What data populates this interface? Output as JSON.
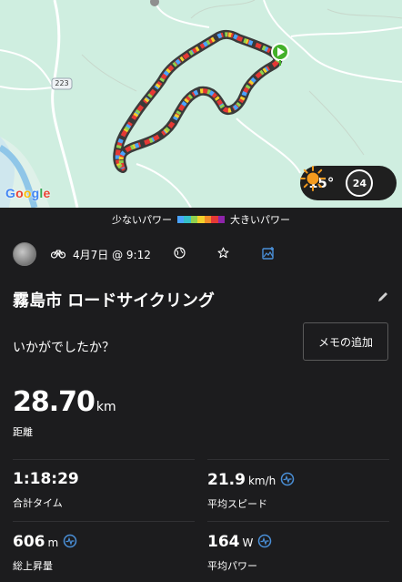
{
  "map": {
    "road_number": "223",
    "google_logo": [
      "G",
      "o",
      "o",
      "g",
      "l",
      "e"
    ],
    "google_colors": [
      "#4285F4",
      "#EA4335",
      "#FBBC05",
      "#4285F4",
      "#34A853",
      "#EA4335"
    ],
    "weather": {
      "temperature": "15°",
      "icon": "sun-icon",
      "uv_index": "24"
    }
  },
  "legend": {
    "low_label": "少ないパワー",
    "high_label": "大きいパワー",
    "colors": [
      "#4aa3ff",
      "#35c0c8",
      "#8fd14f",
      "#f2d02b",
      "#f28c28",
      "#e53935",
      "#8e24aa"
    ]
  },
  "activity": {
    "date": "4月7日 @ 9:12",
    "title": "霧島市 ロードサイクリング",
    "question": "いかがでしたか？",
    "memo_button": "メモの追加"
  },
  "stats": {
    "distance": {
      "value": "28.70",
      "unit": "km",
      "label": "距離"
    },
    "total_time": {
      "value": "1:18:29",
      "unit": "",
      "label": "合計タイム"
    },
    "avg_speed": {
      "value": "21.9",
      "unit": "km/h",
      "label": "平均スピード"
    },
    "elevation": {
      "value": "606",
      "unit": "m",
      "label": "総上昇量"
    },
    "avg_power": {
      "value": "164",
      "unit": "W",
      "label": "平均パワー"
    }
  },
  "colors": {
    "background": "#1c1c1e",
    "accent": "#4a90d9",
    "start_marker": "#43b02a"
  }
}
